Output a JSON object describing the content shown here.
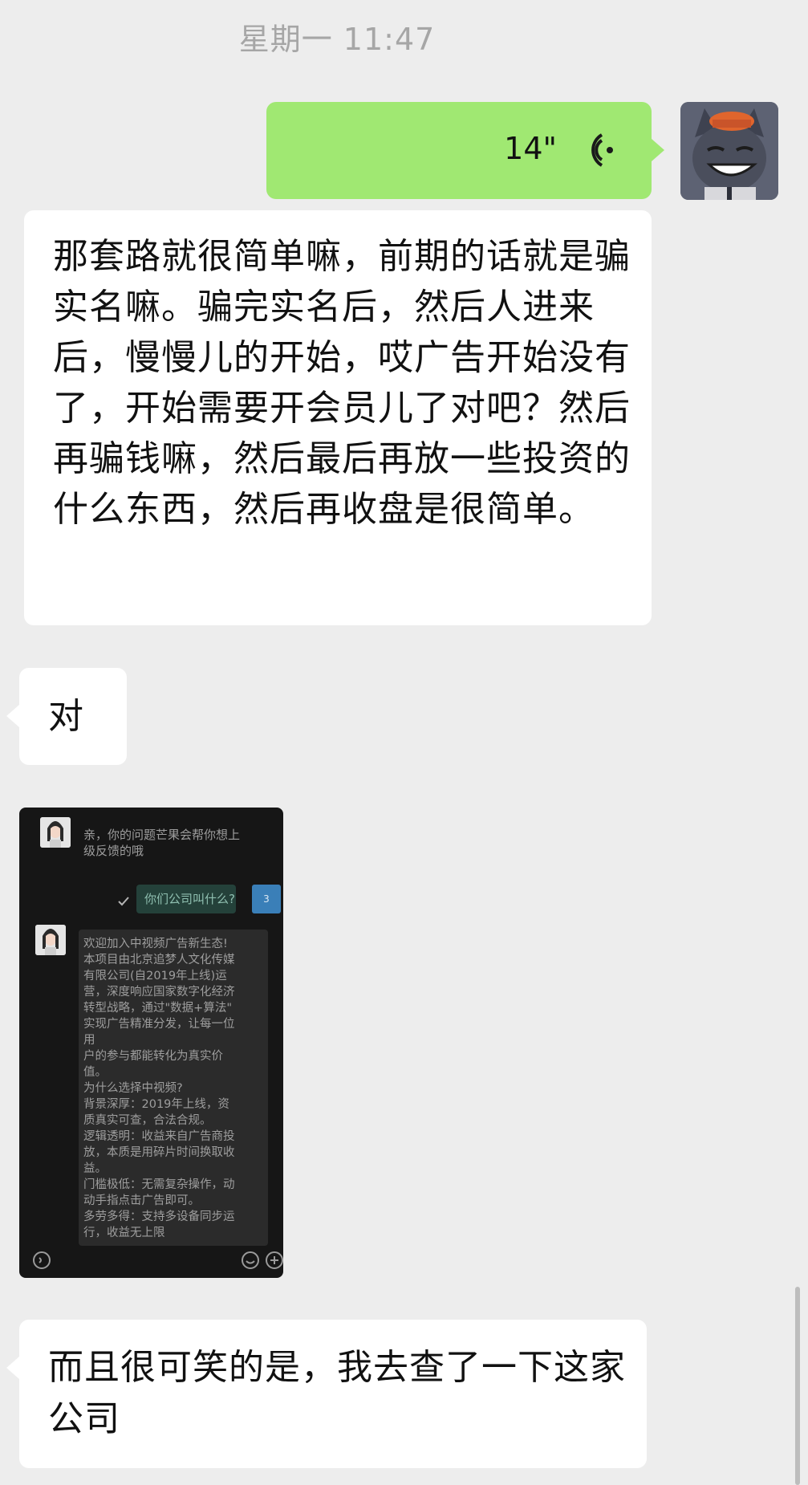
{
  "timestamp": "星期一 11:47",
  "voice_message": {
    "duration": "14\"",
    "icon": "voice-wave-icon"
  },
  "messages": [
    {
      "text": "那套路就很简单嘛，前期的话就是骗实名嘛。骗完实名后，然后人进来后，慢慢儿的开始，哎广告开始没有了，开始需要开会员儿了对吧？然后再骗钱嘛，然后最后再放一些投资的什么东西，然后再收盘是很简单。"
    },
    {
      "text": "对"
    },
    {
      "text": "而且很可笑的是，我去查了一下这家公司"
    }
  ],
  "image_message": {
    "reply_top": "亲，你的问题芒果会帮你想上级反馈的哦",
    "question": "你们公司叫什么?",
    "badge": "3",
    "long_reply": [
      "欢迎加入中视频广告新生态!",
      "本项目由北京追梦人文化传媒",
      "有限公司(自2019年上线)运",
      "营，深度响应国家数字化经济",
      "转型战略，通过\"数据+算法\"",
      "实现广告精准分发，让每一位",
      "用",
      "户的参与都能转化为真实价",
      "值。",
      "为什么选择中视频?",
      "背景深厚：2019年上线，资",
      "质真实可查，合法合规。",
      "逻辑透明：收益来自广告商投",
      "放，本质是用碎片时间换取收",
      "益。",
      "门槛极低：无需复杂操作，动",
      "动手指点击广告即可。",
      "多劳多得：支持多设备同步运",
      "行，收益无上限"
    ]
  },
  "colors": {
    "background": "#ededed",
    "outgoing_bubble": "#a0e872",
    "incoming_bubble": "#ffffff",
    "timestamp_text": "#a6a6a6"
  }
}
